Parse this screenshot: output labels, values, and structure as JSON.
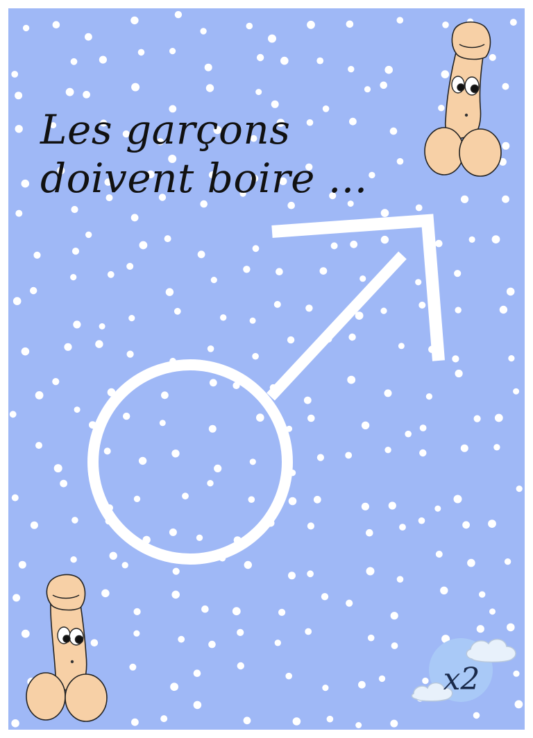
{
  "card": {
    "title_line1": "Les garçons",
    "title_line2": "doivent boire ...",
    "multiplier": "x2"
  },
  "colors": {
    "background": "#9fb8f6",
    "dots": "#ffffff",
    "symbol": "#ffffff",
    "badge": "#a9c9f7",
    "cloud": "#e8f1fb",
    "mascot_skin": "#f7d0a6",
    "text": "#111111"
  },
  "icons": {
    "symbol": "male-symbol-icon",
    "mascot": "cartoon-mascot-icon",
    "badge": "cloud-badge-icon"
  }
}
